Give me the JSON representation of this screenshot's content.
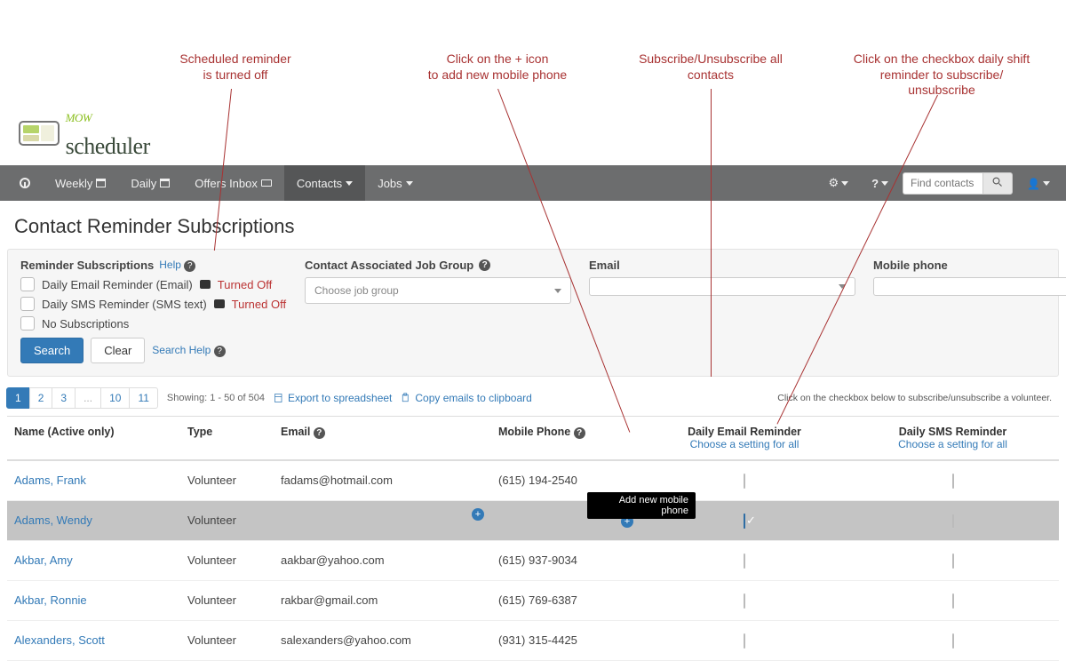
{
  "annotations": {
    "a1": "Scheduled reminder\nis turned off",
    "a2": "Click on the + icon\nto add new mobile phone",
    "a3": "Subscribe/Unsubscribe all\ncontacts",
    "a4": "Click on the checkbox daily shift\nreminder to subscribe/\nunsubscribe"
  },
  "logo": {
    "main": "scheduler",
    "sub": "MOW"
  },
  "nav": {
    "weekly": "Weekly",
    "daily": "Daily",
    "offers": "Offers Inbox",
    "contacts": "Contacts",
    "jobs": "Jobs",
    "search_placeholder": "Find contacts"
  },
  "page_title": "Contact Reminder Subscriptions",
  "filters": {
    "subs_head": "Reminder Subscriptions",
    "help": "Help",
    "opt1": "Daily Email Reminder (Email)",
    "opt2": "Daily SMS Reminder (SMS text)",
    "opt3": "No Subscriptions",
    "turned_off": "Turned Off",
    "job_group_head": "Contact Associated Job Group",
    "job_group_placeholder": "Choose job group",
    "email_head": "Email",
    "mobile_head": "Mobile phone",
    "search_btn": "Search",
    "clear_btn": "Clear",
    "search_help": "Search Help"
  },
  "pagination": {
    "pages": [
      "1",
      "2",
      "3",
      "...",
      "10",
      "11"
    ],
    "active_index": 0,
    "showing": "Showing: 1 - 50 of 504"
  },
  "toolbar": {
    "export": "Export to spreadsheet",
    "copy_emails": "Copy emails to clipboard",
    "note": "Click on the checkbox below to subscribe/unsubscribe a volunteer."
  },
  "table": {
    "headers": {
      "name": "Name (Active only)",
      "type": "Type",
      "email": "Email",
      "mobile": "Mobile Phone",
      "daily_email": "Daily Email Reminder",
      "daily_sms": "Daily SMS Reminder",
      "choose_all": "Choose a setting for all"
    },
    "rows": [
      {
        "name": "Adams, Frank",
        "type": "Volunteer",
        "email": "fadams@hotmail.com",
        "mobile": "(615) 194-2540",
        "daily_email": false,
        "daily_sms": false,
        "highlight": false,
        "show_add": false
      },
      {
        "name": "Adams, Wendy",
        "type": "Volunteer",
        "email": "",
        "mobile": "",
        "daily_email": true,
        "daily_sms": false,
        "highlight": true,
        "show_add": true
      },
      {
        "name": "Akbar, Amy",
        "type": "Volunteer",
        "email": "aakbar@yahoo.com",
        "mobile": "(615) 937-9034",
        "daily_email": false,
        "daily_sms": false,
        "highlight": false,
        "show_add": false
      },
      {
        "name": "Akbar, Ronnie",
        "type": "Volunteer",
        "email": "rakbar@gmail.com",
        "mobile": "(615) 769-6387",
        "daily_email": false,
        "daily_sms": false,
        "highlight": false,
        "show_add": false
      },
      {
        "name": "Alexanders, Scott",
        "type": "Volunteer",
        "email": "salexanders@yahoo.com",
        "mobile": "(931) 315-4425",
        "daily_email": false,
        "daily_sms": false,
        "highlight": false,
        "show_add": false
      }
    ]
  },
  "tooltip": "Add new mobile phone"
}
